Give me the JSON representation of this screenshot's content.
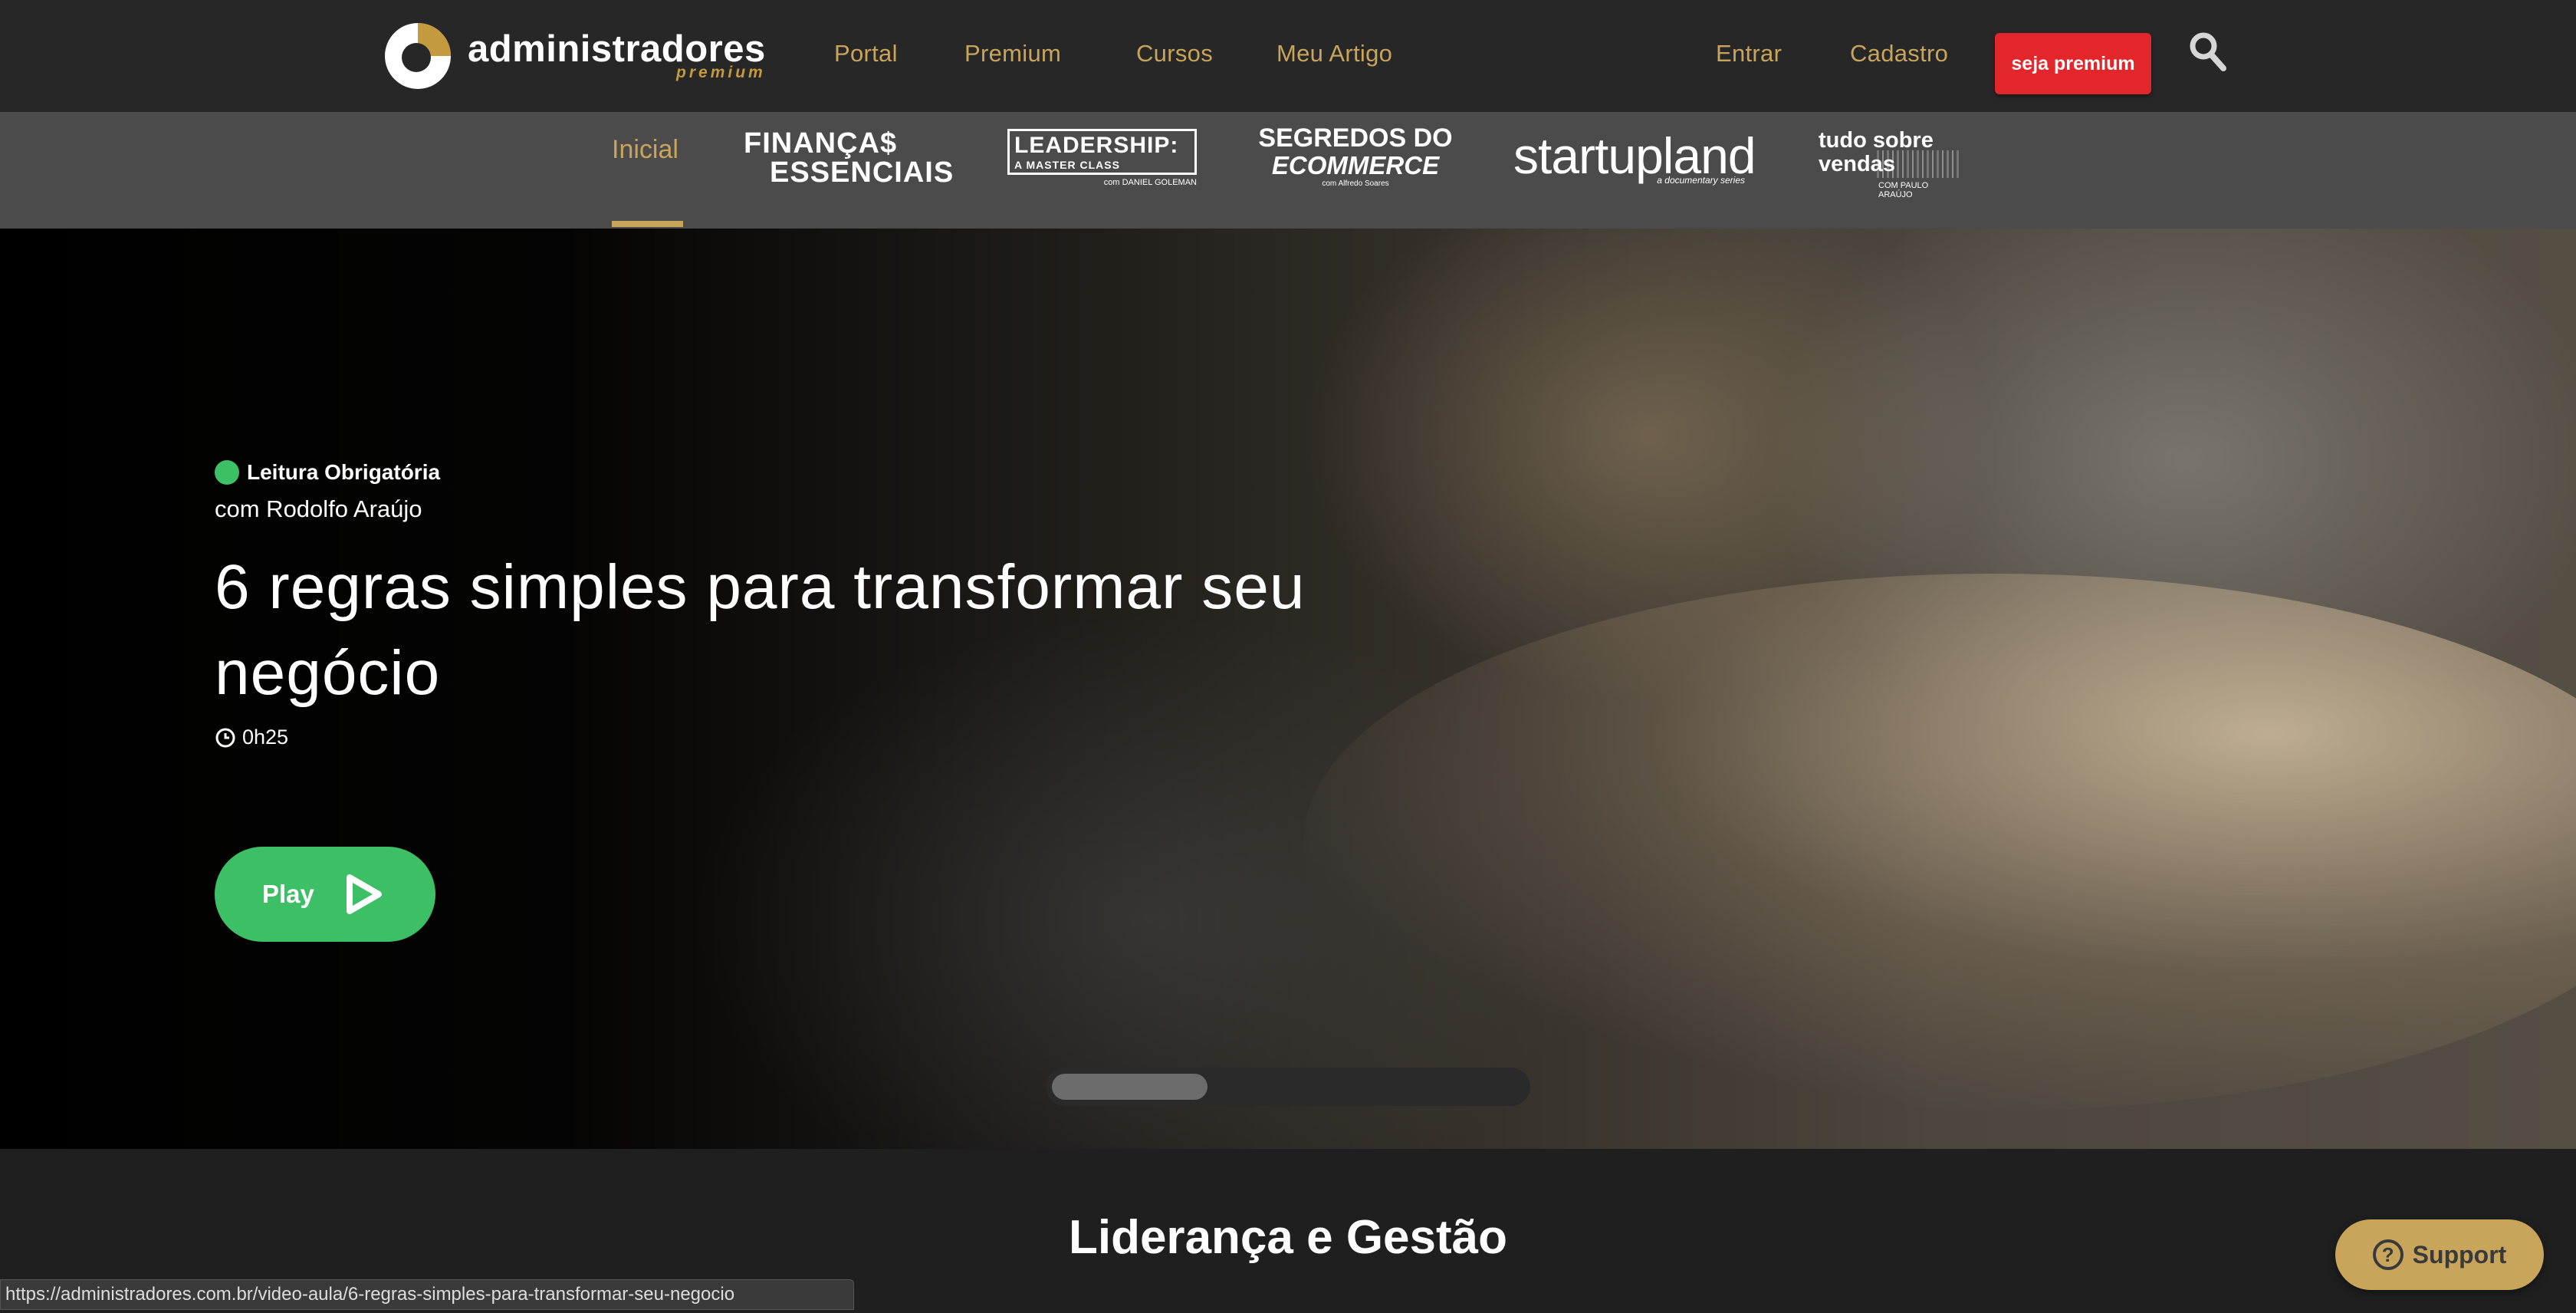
{
  "brand": {
    "name": "administradores",
    "tagline": "premium"
  },
  "nav": {
    "portal": "Portal",
    "premium": "Premium",
    "cursos": "Cursos",
    "meu_artigo": "Meu Artigo",
    "entrar": "Entrar",
    "cadastro": "Cadastro",
    "cta": "seja premium"
  },
  "subnav": {
    "active_tab": "Inicial",
    "series": {
      "financas": {
        "line1": "FINANÇA$",
        "line2": "ESSENCIAIS"
      },
      "leadership": {
        "title": "LEADERSHIP:",
        "subtitle": "A MASTER CLASS",
        "by": "com DANIEL GOLEMAN"
      },
      "ecommerce": {
        "line1": "SEGREDOS DO",
        "line2": "ECOMMERCE",
        "by": "com Alfredo Soares"
      },
      "startupland": {
        "name": "startupland",
        "sub": "a documentary series"
      },
      "vendas": {
        "line1": "tudo sobre",
        "line2": "vendas",
        "by": "COM PAULO ARAÚJO"
      }
    }
  },
  "hero": {
    "badge": "Leitura Obrigatória",
    "author": "com Rodolfo Araújo",
    "title": "6 regras simples para transformar seu negócio",
    "duration": "0h25",
    "play_label": "Play",
    "carousel_progress": 0.33
  },
  "section": {
    "title": "Liderança e Gestão"
  },
  "status_url": "https://administradores.com.br/video-aula/6-regras-simples-para-transformar-seu-negocio",
  "support": {
    "label": "Support"
  },
  "colors": {
    "gold": "#c8a55a",
    "green": "#3dbf66",
    "red": "#e3262b"
  }
}
